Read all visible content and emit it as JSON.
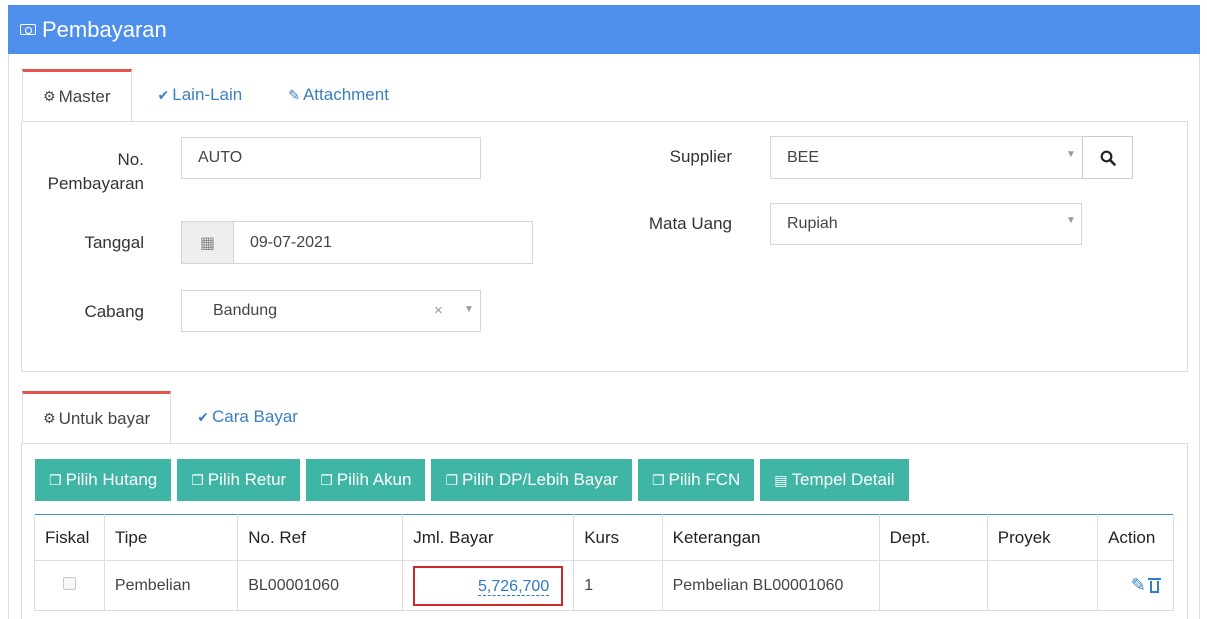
{
  "header": {
    "title": "Pembayaran",
    "icon": "money-icon",
    "color": "#4f8fec"
  },
  "master_tabs": [
    {
      "label": "Master",
      "icon": "gears-icon",
      "active": true
    },
    {
      "label": "Lain-Lain",
      "icon": "check-circle-icon",
      "active": false
    },
    {
      "label": "Attachment",
      "icon": "paperclip-icon",
      "active": false
    }
  ],
  "form": {
    "no_pembayaran": {
      "label": "No. Pembayaran",
      "label_line1": "No.",
      "label_line2": "Pembayaran",
      "value": "AUTO"
    },
    "tanggal": {
      "label": "Tanggal",
      "value": "09-07-2021"
    },
    "cabang": {
      "label": "Cabang",
      "value": "Bandung"
    },
    "supplier": {
      "label": "Supplier",
      "value": "BEE"
    },
    "mata_uang": {
      "label": "Mata Uang",
      "value": "Rupiah"
    }
  },
  "detail_tabs": [
    {
      "label": "Untuk bayar",
      "icon": "gears-icon",
      "active": true
    },
    {
      "label": "Cara Bayar",
      "icon": "check-circle-icon",
      "active": false
    }
  ],
  "buttons": [
    {
      "label": "Pilih Hutang",
      "icon": "copy-icon"
    },
    {
      "label": "Pilih Retur",
      "icon": "copy-icon"
    },
    {
      "label": "Pilih Akun",
      "icon": "copy-icon"
    },
    {
      "label": "Pilih DP/Lebih Bayar",
      "icon": "copy-icon"
    },
    {
      "label": "Pilih FCN",
      "icon": "copy-icon"
    },
    {
      "label": "Tempel Detail",
      "icon": "paste-icon"
    }
  ],
  "button_color": "#3fb5a5",
  "table": {
    "columns": [
      "Fiskal",
      "Tipe",
      "No. Ref",
      "Jml. Bayar",
      "Kurs",
      "Keterangan",
      "Dept.",
      "Proyek",
      "Action"
    ],
    "rows": [
      {
        "fiskal": false,
        "tipe": "Pembelian",
        "no_ref": "BL00001060",
        "jml_bayar": "5,726,700",
        "kurs": "1",
        "keterangan": "Pembelian BL00001060",
        "dept": "",
        "proyek": ""
      }
    ]
  }
}
